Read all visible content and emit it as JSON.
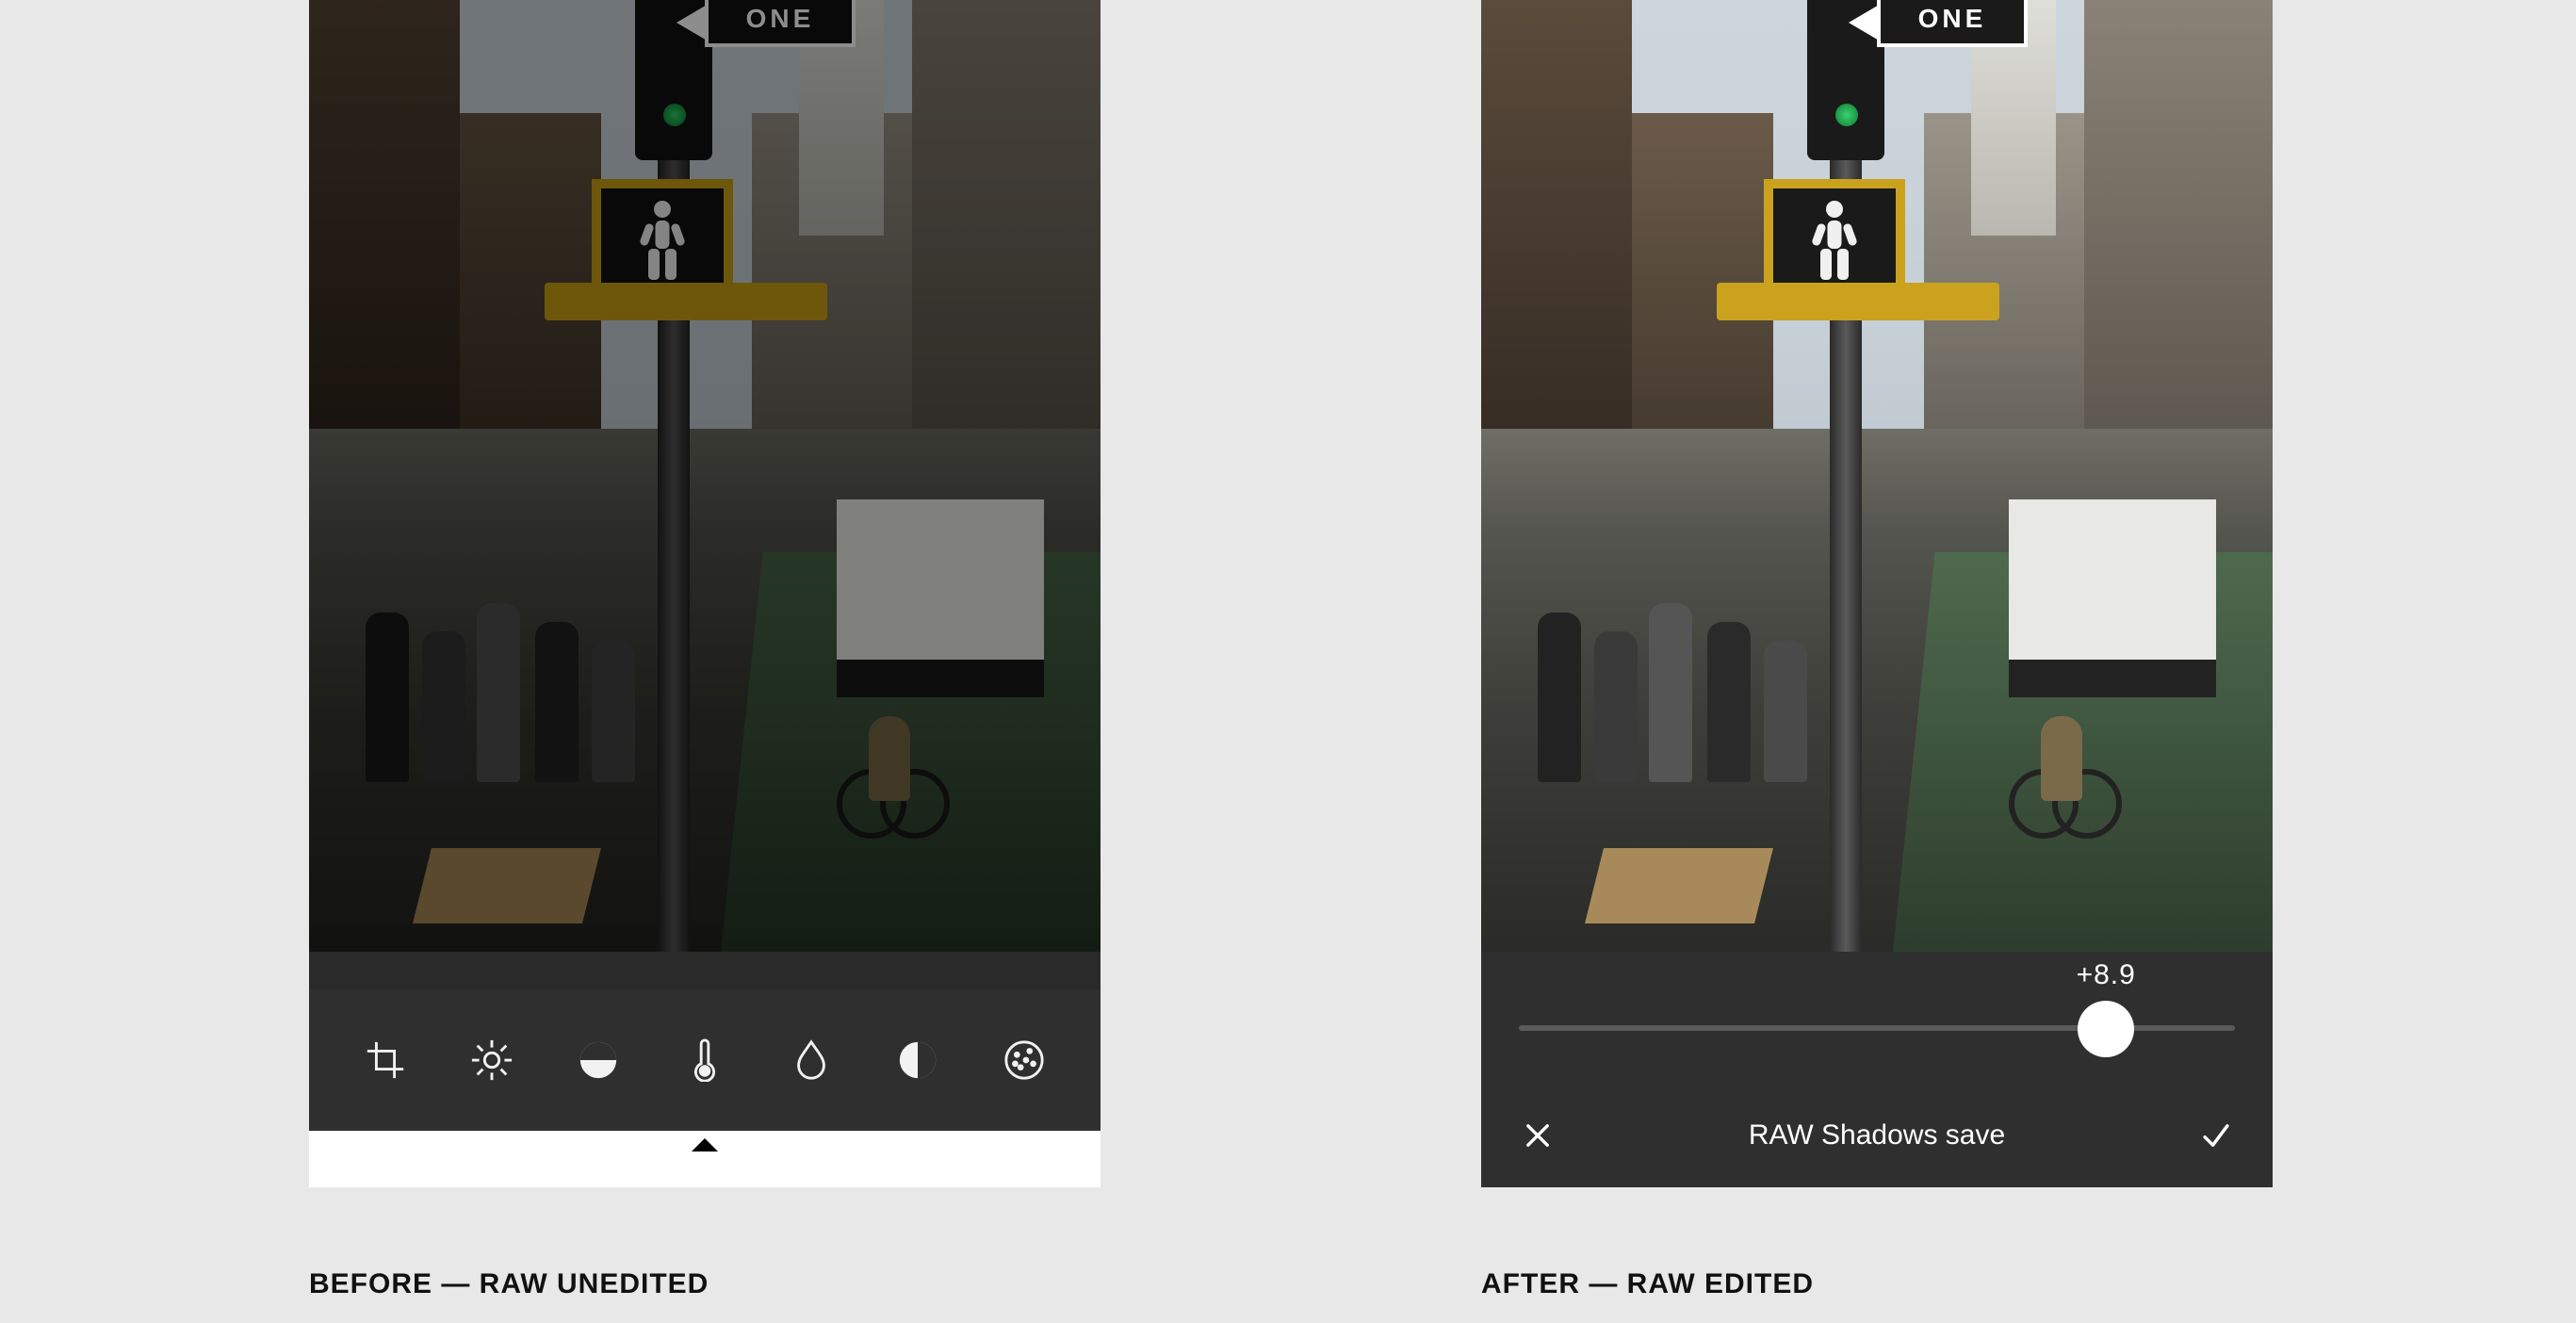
{
  "captions": {
    "before": "BEFORE — RAW UNEDITED",
    "after": "AFTER — RAW EDITED"
  },
  "sign": {
    "one_way": "ONE"
  },
  "left_panel": {
    "tools": [
      {
        "id": "crop",
        "name": "crop-icon"
      },
      {
        "id": "exposure",
        "name": "brightness-icon"
      },
      {
        "id": "tone",
        "name": "tone-split-icon"
      },
      {
        "id": "temperature",
        "name": "thermometer-icon"
      },
      {
        "id": "sharpen",
        "name": "drop-icon"
      },
      {
        "id": "contrast",
        "name": "contrast-icon"
      },
      {
        "id": "grain",
        "name": "grain-icon"
      }
    ]
  },
  "right_panel": {
    "slider": {
      "value_label": "+8.9",
      "value": 8.9,
      "min": -12,
      "max": 12,
      "knob_percent": 82
    },
    "confirm": {
      "title": "RAW Shadows save",
      "cancel_icon": "close-icon",
      "accept_icon": "check-icon"
    }
  }
}
